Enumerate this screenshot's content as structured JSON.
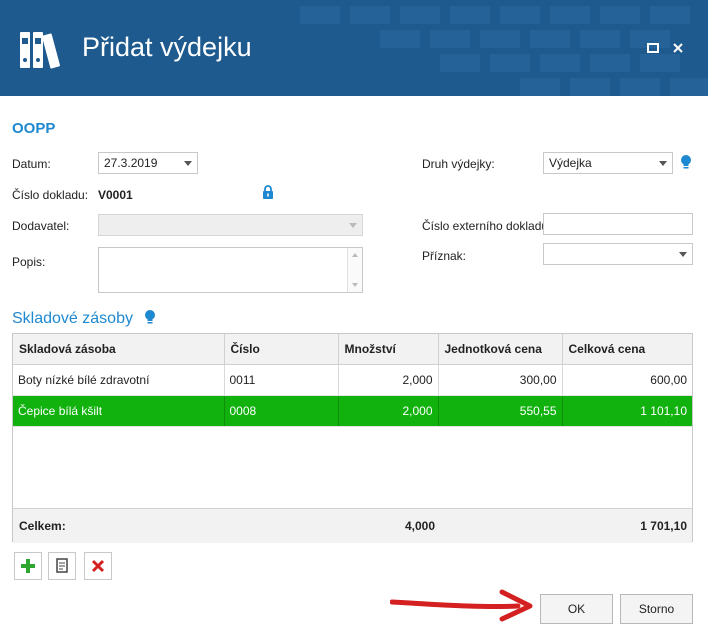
{
  "window": {
    "title": "Přidat výdejku",
    "maximize_icon": "maximize-icon",
    "close_icon": "close-icon"
  },
  "form": {
    "section_title": "OOPP",
    "datum_label": "Datum:",
    "datum_value": "27.3.2019",
    "cislo_dokladu_label": "Číslo dokladu:",
    "cislo_dokladu_value": "V0001",
    "dodavatel_label": "Dodavatel:",
    "dodavatel_value": "",
    "popis_label": "Popis:",
    "popis_value": "",
    "druh_label": "Druh výdejky:",
    "druh_value": "Výdejka",
    "externi_label": "Číslo externího dokladu:",
    "externi_value": "",
    "priznak_label": "Příznak:",
    "priznak_value": ""
  },
  "stock": {
    "title": "Skladové zásoby",
    "columns": [
      "Skladová zásoba",
      "Číslo",
      "Množství",
      "Jednotková cena",
      "Celková cena"
    ],
    "rows": [
      {
        "name": "Boty nízké bílé zdravotní",
        "number": "0011",
        "qty": "2,000",
        "unit_price": "300,00",
        "total": "600,00",
        "selected": false
      },
      {
        "name": "Čepice bílá kšilt",
        "number": "0008",
        "qty": "2,000",
        "unit_price": "550,55",
        "total": "1 101,10",
        "selected": true
      }
    ],
    "footer": {
      "label": "Celkem:",
      "qty": "4,000",
      "total": "1 701,10"
    }
  },
  "buttons": {
    "ok": "OK",
    "storno": "Storno"
  },
  "colors": {
    "titlebar": "#1e5a8e",
    "accent": "#1e88d0",
    "selected_row": "#12b20e",
    "arrow": "#d42020"
  }
}
